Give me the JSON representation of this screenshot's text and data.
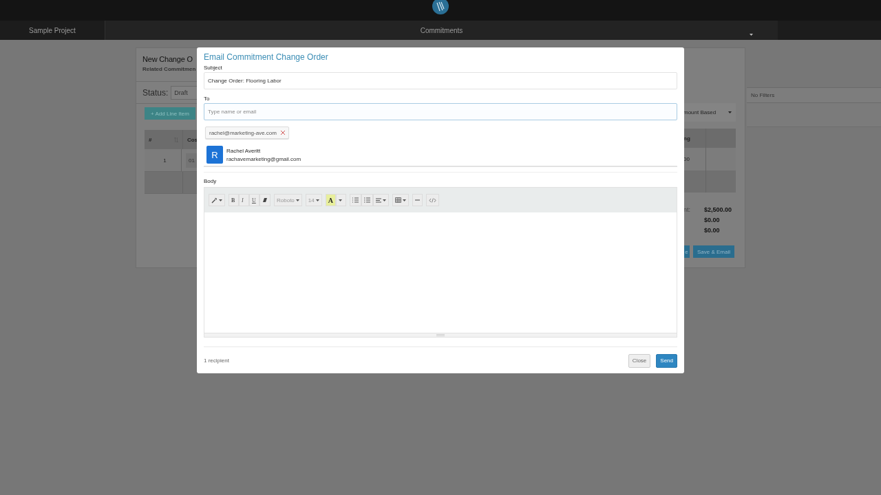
{
  "nav": {
    "project": "Sample Project",
    "section": "Commitments"
  },
  "background_card": {
    "title": "New Change O",
    "subtitle": "Related Commitmen",
    "status_label": "Status:",
    "status_value": "Draft",
    "add_button": "+ Add Line Item",
    "header": [
      "#",
      "Cos"
    ],
    "row": [
      "1",
      "01"
    ],
    "type_dropdown": "mount Based",
    "right_header": "ng",
    "right_cell": "00",
    "totals_label": "nt:",
    "totals": [
      "$2,500.00",
      "$0.00",
      "$0.00"
    ],
    "buttons": [
      "e",
      "Save & Email"
    ]
  },
  "filters": "No Filters",
  "modal": {
    "title": "Email Commitment Change Order",
    "subject_label": "Subject",
    "subject": "Change Order: Flooring Labor",
    "to_label": "To",
    "to_placeholder": "Type name or email",
    "recipients": [
      {
        "email": "rachel@marketing-ave.com"
      }
    ],
    "suggestions": [
      {
        "initial": "R",
        "name": "Rachel Averitt",
        "email": "rachavemarketing@gmail.com"
      }
    ],
    "body_label": "Body",
    "toolbar": [
      {
        "kind": "style"
      },
      {
        "kind": "format",
        "labels": [
          "B",
          "I",
          "U"
        ]
      },
      {
        "kind": "font",
        "label": "Roboto"
      },
      {
        "kind": "size",
        "label": "14"
      },
      {
        "kind": "color",
        "label": "A"
      },
      {
        "kind": "para"
      },
      {
        "kind": "table"
      },
      {
        "kind": "rule"
      },
      {
        "kind": "code"
      }
    ],
    "count": "1 recipient",
    "buttons": [
      "Close",
      "Send"
    ]
  }
}
